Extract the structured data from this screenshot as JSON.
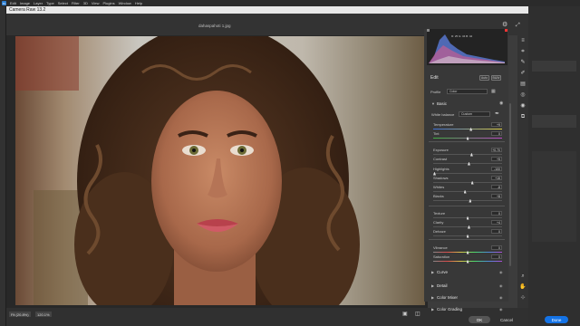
{
  "app_menu": [
    "Edit",
    "Image",
    "Layer",
    "Type",
    "Select",
    "Filter",
    "3D",
    "View",
    "Plugins",
    "Window",
    "Help"
  ],
  "dialog_title": "Camera Raw 13.2",
  "file_name": "dahaspahoti 1.jpg",
  "histogram_readout": "R: 25   G: 34   B: 42",
  "panel": {
    "edit_label": "Edit",
    "auto_label": "Auto",
    "bw_label": "B&W",
    "profile_label": "Profile",
    "profile_value": "Color",
    "basic_label": "Basic",
    "wb_label": "White balance",
    "wb_value": "Custom",
    "sections": [
      "Curve",
      "Detail",
      "Color Mixer",
      "Color Grading"
    ]
  },
  "sliders": [
    {
      "name": "Temperature",
      "value": "+9",
      "pos": 0.55,
      "grad": "temp"
    },
    {
      "name": "Tint",
      "value": "0",
      "pos": 0.5,
      "grad": "tint"
    },
    {
      "name": "Exposure",
      "value": "+0.70",
      "pos": 0.56,
      "grad": "none"
    },
    {
      "name": "Contrast",
      "value": "+5",
      "pos": 0.52,
      "grad": "none"
    },
    {
      "name": "Highlights",
      "value": "-100",
      "pos": 0.0,
      "grad": "none"
    },
    {
      "name": "Shadows",
      "value": "+15",
      "pos": 0.57,
      "grad": "none"
    },
    {
      "name": "Whites",
      "value": "-8",
      "pos": 0.46,
      "grad": "none"
    },
    {
      "name": "Blacks",
      "value": "+8",
      "pos": 0.54,
      "grad": "none"
    },
    {
      "name": "Texture",
      "value": "0",
      "pos": 0.5,
      "grad": "none"
    },
    {
      "name": "Clarity",
      "value": "+4",
      "pos": 0.52,
      "grad": "none"
    },
    {
      "name": "Dehaze",
      "value": "0",
      "pos": 0.5,
      "grad": "none"
    },
    {
      "name": "Vibrance",
      "value": "0",
      "pos": 0.5,
      "grad": "vib"
    },
    {
      "name": "Saturation",
      "value": "0",
      "pos": 0.5,
      "grad": "sat"
    }
  ],
  "zoom_fit": "Fit (20.8%)",
  "zoom_value": "120.1%",
  "ok_label": "OK",
  "cancel_label": "Cancel",
  "done_label": "Done"
}
